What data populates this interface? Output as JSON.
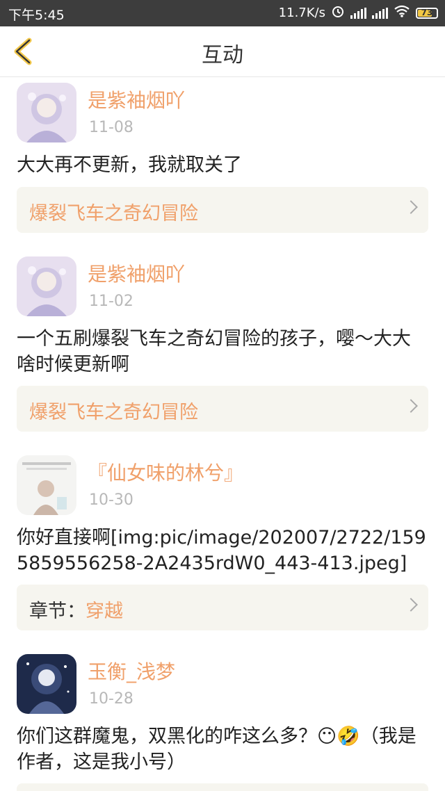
{
  "status_bar": {
    "time": "下午5:45",
    "net_speed": "11.7K/s",
    "battery": "73"
  },
  "nav": {
    "title": "互动"
  },
  "posts": [
    {
      "username": "是紫袖烟吖",
      "date": "11-08",
      "content": "大大再不更新，我就取关了",
      "ref_prefix": "",
      "ref_text": "爆裂飞车之奇幻冒险"
    },
    {
      "username": "是紫袖烟吖",
      "date": "11-02",
      "content": "一个五刷爆裂飞车之奇幻冒险的孩子，嘤～大大啥时候更新啊",
      "ref_prefix": "",
      "ref_text": "爆裂飞车之奇幻冒险"
    },
    {
      "username": "『仙女味的林兮』",
      "date": "10-30",
      "content": "你好直接啊[img:pic/image/202007/2722/1595859556258-2A2435rdW0_443-413.jpeg]",
      "ref_prefix": "章节：",
      "ref_text": "穿越"
    },
    {
      "username": "玉衡_浅梦",
      "date": "10-28",
      "content": "你们这群魔鬼，双黑化的咋这么多？😶🤣（我是作者，这是我小号）",
      "ref_prefix": "",
      "ref_text": ""
    }
  ],
  "colors": {
    "accent": "#f0a06a",
    "card_bg": "#f6f5ef",
    "status_bg": "#3d3d3d"
  }
}
